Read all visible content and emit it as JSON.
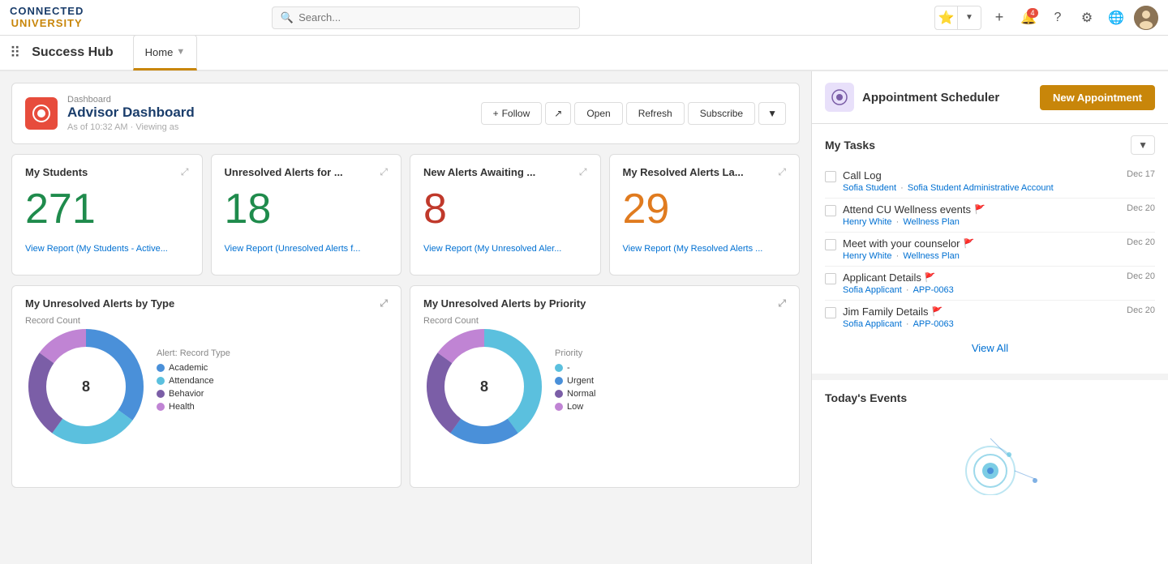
{
  "app": {
    "logo_line1": "CONNECTED",
    "logo_line2": "UNIVERSITY"
  },
  "topnav": {
    "search_placeholder": "Search...",
    "notification_count": "4"
  },
  "appbar": {
    "title": "Success Hub",
    "home_tab": "Home"
  },
  "dashboard": {
    "breadcrumb": "Dashboard",
    "title": "Advisor Dashboard",
    "meta": "As of                 10:32 AM · Viewing as",
    "follow_label": "Follow",
    "open_label": "Open",
    "refresh_label": "Refresh",
    "subscribe_label": "Subscribe"
  },
  "stats": [
    {
      "title": "My Students",
      "number": "271",
      "number_class": "stat-green",
      "link": "View Report (My Students - Active..."
    },
    {
      "title": "Unresolved Alerts for ...",
      "number": "18",
      "number_class": "stat-green",
      "link": "View Report (Unresolved Alerts f..."
    },
    {
      "title": "New Alerts Awaiting ...",
      "number": "8",
      "number_class": "stat-red",
      "link": "View Report (My Unresolved Aler..."
    },
    {
      "title": "My Resolved Alerts La...",
      "number": "29",
      "number_class": "stat-orange",
      "link": "View Report (My Resolved Alerts ..."
    }
  ],
  "charts": [
    {
      "title": "My Unresolved Alerts by Type",
      "subtitle": "Alert: Record Type",
      "label": "Record Count",
      "center_value": "8",
      "legend": [
        {
          "name": "Academic",
          "color": "#4a90d9"
        },
        {
          "name": "Attendance",
          "color": "#5bc0de"
        },
        {
          "name": "Behavior",
          "color": "#7b5ea7"
        },
        {
          "name": "Health",
          "color": "#c084d4"
        }
      ],
      "segments": [
        {
          "color": "#4a90d9",
          "pct": 35
        },
        {
          "color": "#5bc0de",
          "pct": 25
        },
        {
          "color": "#7b5ea7",
          "pct": 25
        },
        {
          "color": "#c084d4",
          "pct": 15
        }
      ]
    },
    {
      "title": "My Unresolved Alerts by Priority",
      "subtitle": "Priority",
      "label": "Record Count",
      "center_value": "8",
      "legend": [
        {
          "name": "-",
          "color": "#5bc0de"
        },
        {
          "name": "Urgent",
          "color": "#4a90d9"
        },
        {
          "name": "Normal",
          "color": "#7b5ea7"
        },
        {
          "name": "Low",
          "color": "#c084d4"
        }
      ],
      "segments": [
        {
          "color": "#5bc0de",
          "pct": 40
        },
        {
          "color": "#4a90d9",
          "pct": 20
        },
        {
          "color": "#7b5ea7",
          "pct": 25
        },
        {
          "color": "#c084d4",
          "pct": 15
        }
      ]
    }
  ],
  "appointment": {
    "title": "Appointment Scheduler",
    "new_appt_label": "New Appointment"
  },
  "tasks": {
    "section_title": "My Tasks",
    "view_all": "View All",
    "items": [
      {
        "name": "Call Log",
        "flagged": false,
        "date": "Dec 17",
        "link1": "Sofia Student",
        "sep": "·",
        "link2": "Sofia Student Administrative Account"
      },
      {
        "name": "Attend CU Wellness events",
        "flagged": true,
        "date": "Dec 20",
        "link1": "Henry White",
        "sep": "·",
        "link2": "Wellness Plan"
      },
      {
        "name": "Meet with your counselor",
        "flagged": true,
        "date": "Dec 20",
        "link1": "Henry White",
        "sep": "·",
        "link2": "Wellness Plan"
      },
      {
        "name": "Applicant Details",
        "flagged": true,
        "date": "Dec 20",
        "link1": "Sofia Applicant",
        "sep": "·",
        "link2": "APP-0063"
      },
      {
        "name": "Jim Family Details",
        "flagged": true,
        "date": "Dec 20",
        "link1": "Sofia Applicant",
        "sep": "·",
        "link2": "APP-0063"
      }
    ]
  },
  "events": {
    "title": "Today's Events"
  }
}
